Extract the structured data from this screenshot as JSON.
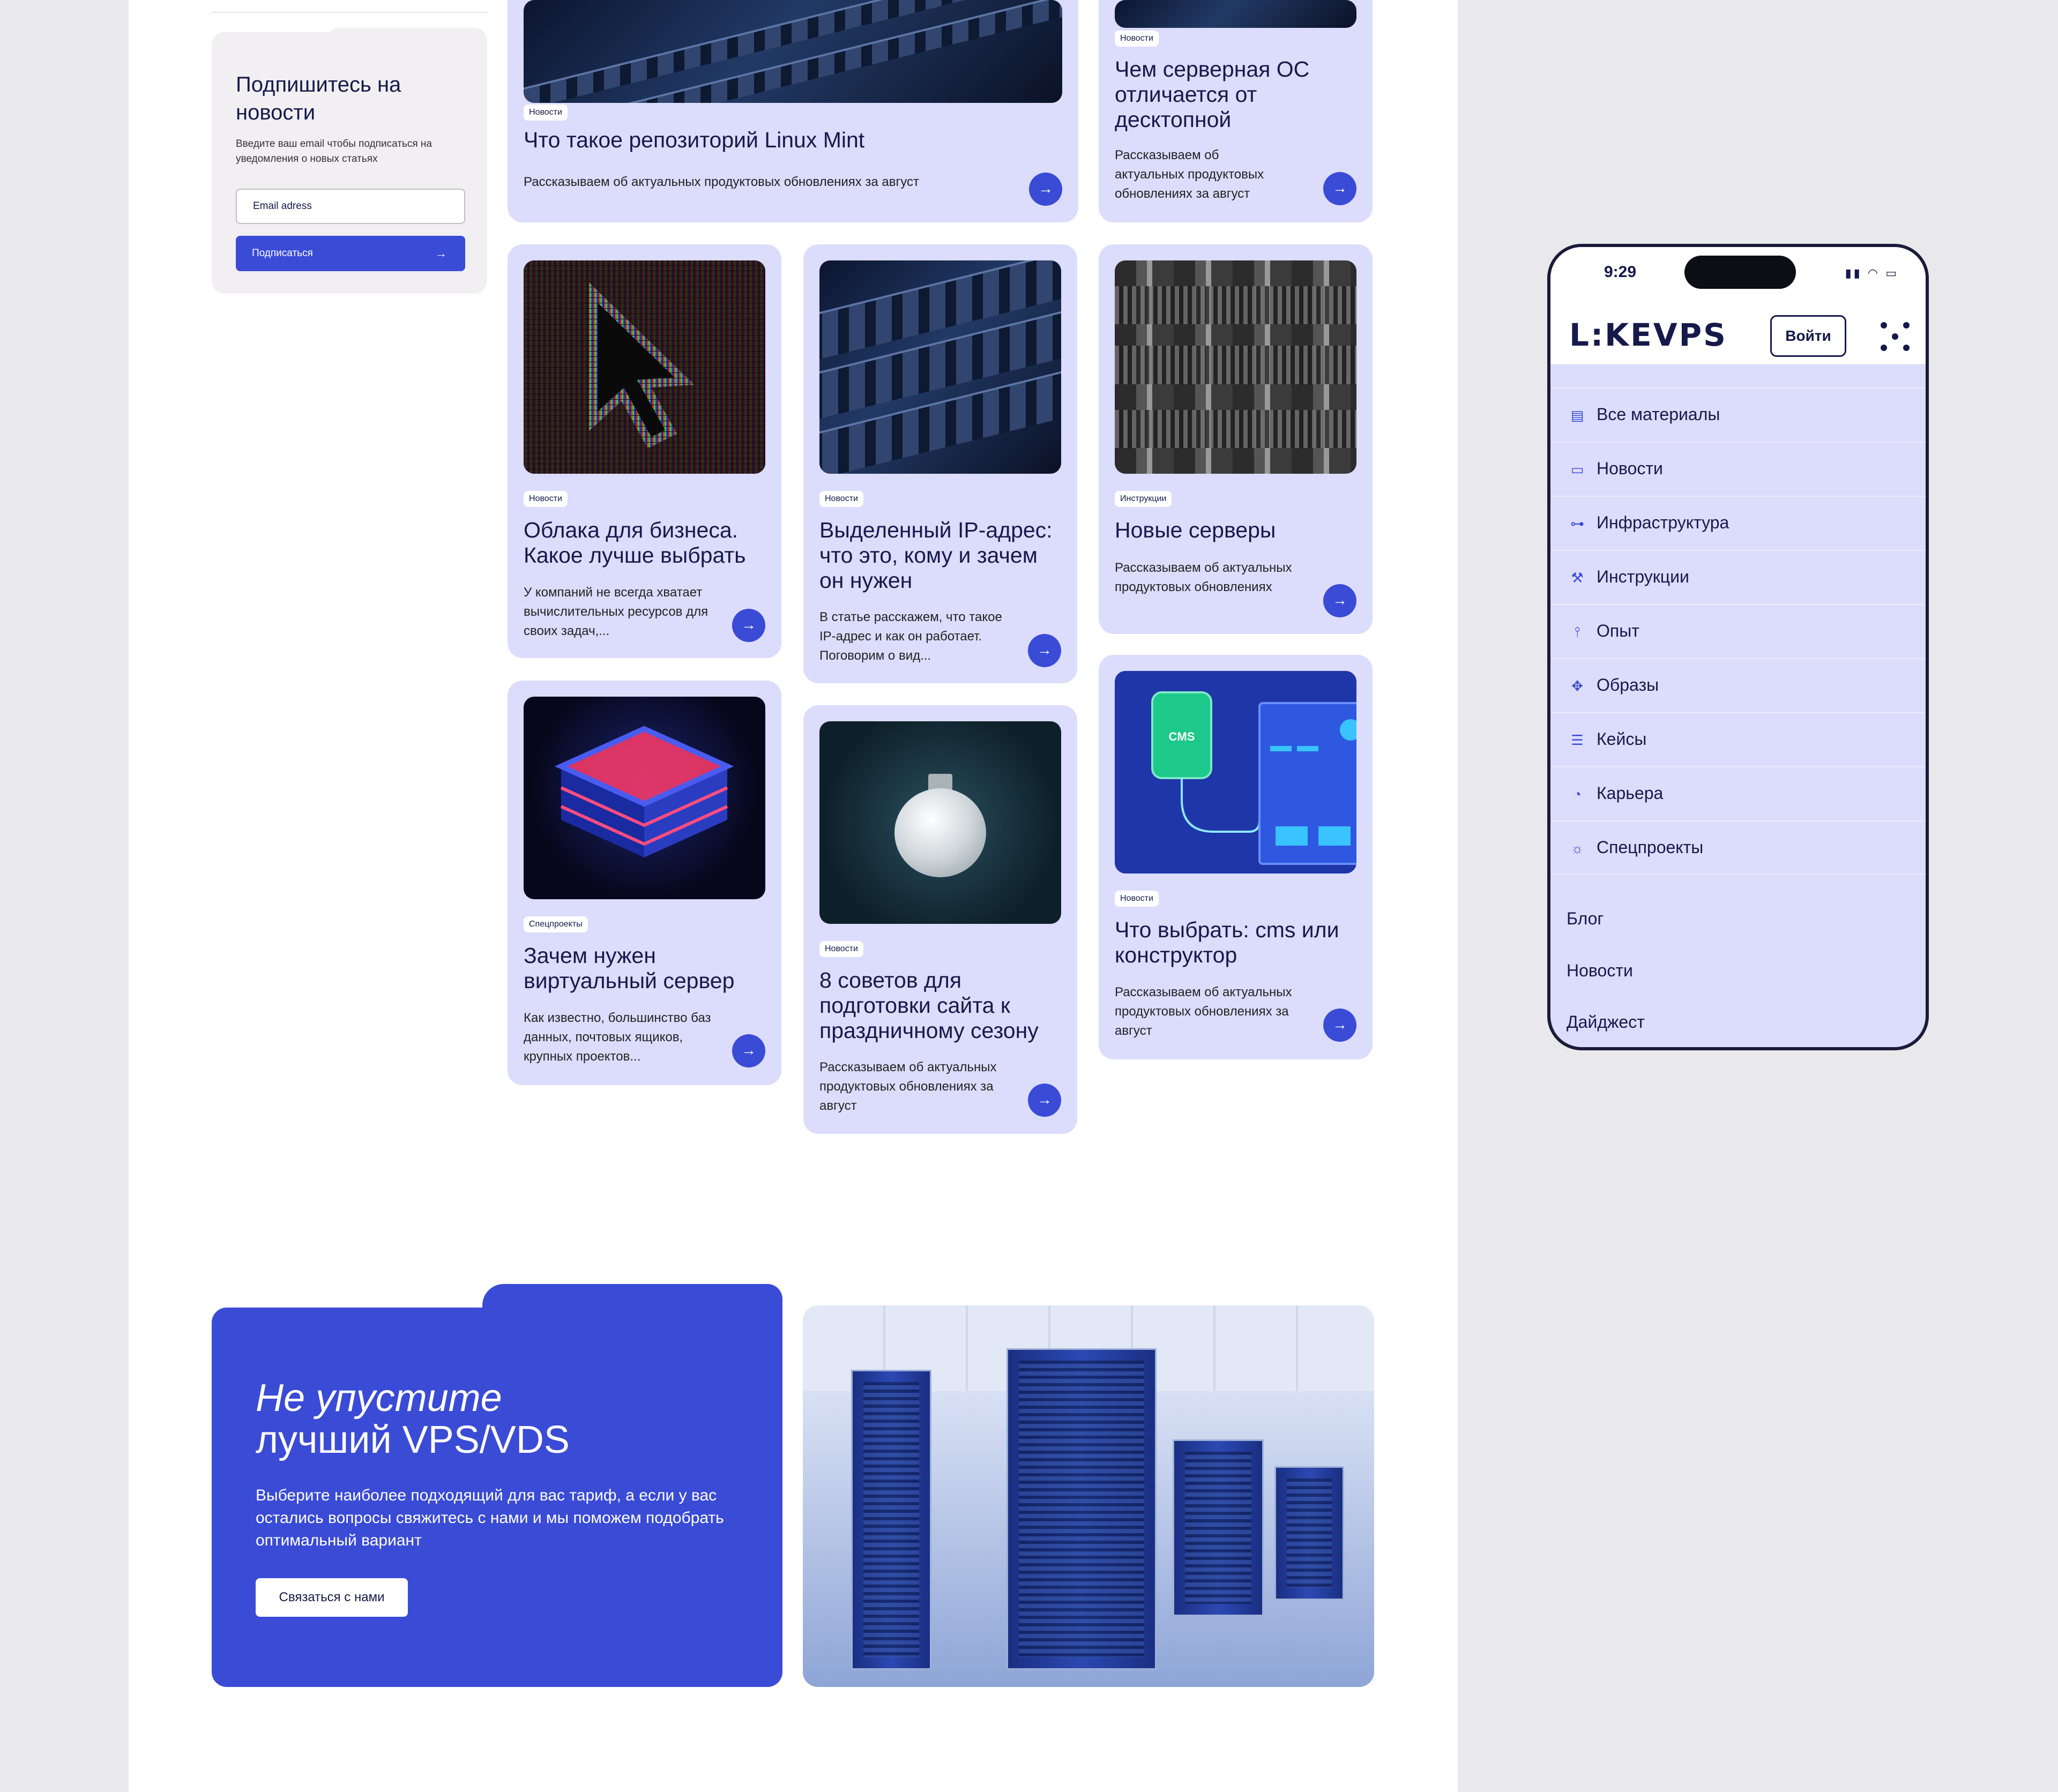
{
  "subscribe": {
    "title": "Подпишитесь на новости",
    "description": "Введите ваш email чтобы подписаться на уведомления о новых статьях",
    "email_placeholder": "Email adress",
    "button_label": "Подписаться"
  },
  "cards": [
    {
      "badge": "Новости",
      "title": "Что такое репозиторий Linux Mint",
      "desc": "Рассказываем об актуальных продуктовых обновлениях за август"
    },
    {
      "badge": "Новости",
      "title": "Чем серверная ОС отличается от десктопной",
      "desc": "Рассказываем об актуальных продуктовых обновлениях за август"
    },
    {
      "badge": "Новости",
      "title": "Облака для бизнеса. Какое лучше выбрать",
      "desc": "У компаний не всегда хватает вычислительных ресурсов для своих задач,..."
    },
    {
      "badge": "Новости",
      "title": "Выделенный IP-адрес: что это, кому и зачем он нужен",
      "desc": "В статье расскажем, что такое IP-адрес и как он работает. Поговорим о вид..."
    },
    {
      "badge": "Инструкции",
      "title": "Новые серверы",
      "desc": "Рассказываем об актуальных продуктовых обновлениях"
    },
    {
      "badge": "Спецпроекты",
      "title": "Зачем нужен виртуальный сервер",
      "desc": "Как известно, большинство баз данных, почтовых ящиков, крупных проектов..."
    },
    {
      "badge": "Новости",
      "title": "8 советов для подготовки сайта к праздничному сезону",
      "desc": "Рассказываем об актуальных продуктовых обновлениях за август"
    },
    {
      "badge": "Новости",
      "title": "Что выбрать: cms или конструктор",
      "desc": "Рассказываем об актуальных продуктовых обновлениях за август"
    }
  ],
  "image_text": {
    "cms_label": "CMS"
  },
  "cta": {
    "title_line1": "Не упустите",
    "title_line2": "лучший VPS/VDS",
    "description": "Выберите наиболее подходящий для вас тариф, а если у вас остались вопросы свяжитесь с нами и мы поможем подобрать оптимальный вариант",
    "button_label": "Связаться с нами"
  },
  "phone": {
    "time": "9:29",
    "logo": "L:KEVPS",
    "login_label": "Войти",
    "menu": [
      {
        "icon": "document-icon",
        "label": "Все материалы"
      },
      {
        "icon": "window-icon",
        "label": "Новости"
      },
      {
        "icon": "hierarchy-icon",
        "label": "Инфраструктура"
      },
      {
        "icon": "wrench-icon",
        "label": "Инструкции"
      },
      {
        "icon": "thermometer-icon",
        "label": "Опыт"
      },
      {
        "icon": "move-icon",
        "label": "Образы"
      },
      {
        "icon": "list-icon",
        "label": "Кейсы"
      },
      {
        "icon": "gauge-icon",
        "label": "Карьера"
      },
      {
        "icon": "bulb-icon",
        "label": "Спецпроекты"
      }
    ],
    "secondary": [
      "Блог",
      "Новости",
      "Дайджест"
    ]
  },
  "colors": {
    "accent": "#3a4bd6",
    "card_bg": "#dcdcfd",
    "text": "#151a4a"
  }
}
